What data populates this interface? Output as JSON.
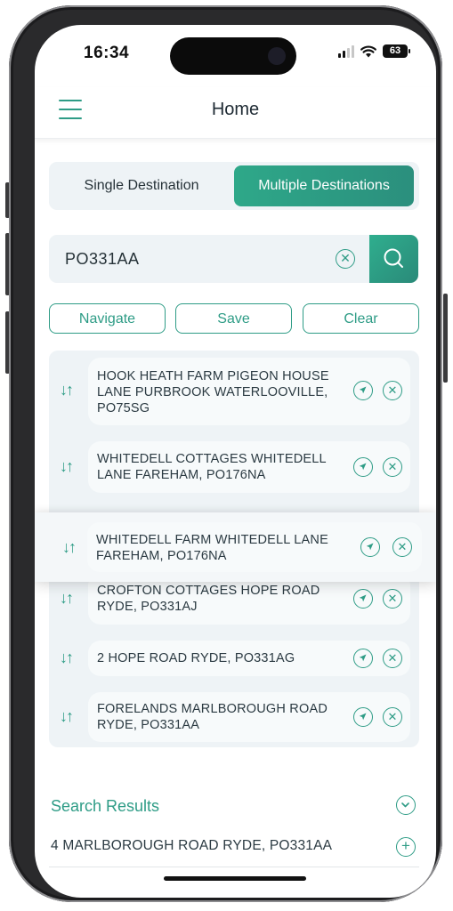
{
  "status_bar": {
    "time": "16:34",
    "battery": "63"
  },
  "header": {
    "title": "Home"
  },
  "segments": {
    "single": "Single Destination",
    "multiple": "Multiple Destinations",
    "selected": "multiple"
  },
  "search": {
    "value": "PO331AA",
    "placeholder": ""
  },
  "actions": {
    "navigate": "Navigate",
    "save": "Save",
    "clear": "Clear"
  },
  "destinations": [
    {
      "lines": [
        "HOOK HEATH FARM  PIGEON HOUSE",
        "LANE  PURBROOK WATERLOOVILLE,",
        "PO75SG"
      ]
    },
    {
      "lines": [
        "WHITEDELL COTTAGES  WHITEDELL",
        "LANE  FAREHAM, PO176NA"
      ]
    },
    {
      "lines": [
        "WHITEDELL FARM  WHITEDELL LANE",
        "FAREHAM, PO176NA"
      ]
    },
    {
      "lines": [
        "CROFTON COTTAGES  HOPE ROAD",
        "RYDE, PO331AJ"
      ]
    },
    {
      "lines": [
        "2 HOPE ROAD  RYDE, PO331AG"
      ]
    },
    {
      "lines": [
        "FORELANDS  MARLBOROUGH ROAD",
        "RYDE, PO331AA"
      ]
    }
  ],
  "results": {
    "title": "Search Results",
    "items": [
      "4 MARLBOROUGH ROAD  RYDE, PO331AA"
    ]
  },
  "icons": {
    "menu": "menu-icon",
    "clear": "clear-icon",
    "search": "search-icon",
    "sort": "sort-icon",
    "navigate": "navigation-arrow-icon",
    "remove": "remove-icon",
    "collapse": "chevron-down-icon",
    "add": "plus-icon"
  },
  "colors": {
    "accent": "#2e9c86",
    "panel": "#eef3f6",
    "text": "#2b3a42"
  }
}
